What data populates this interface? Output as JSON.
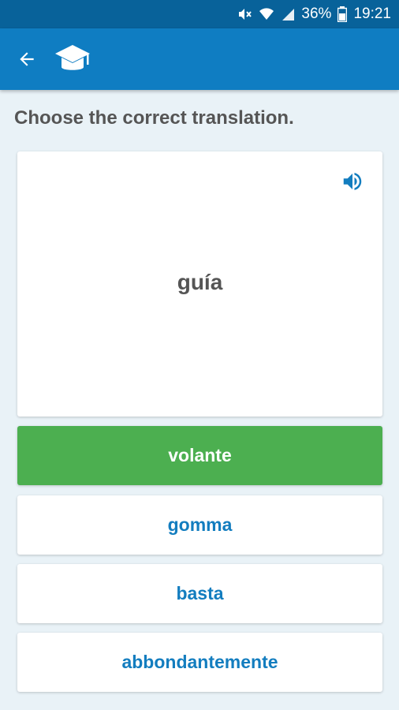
{
  "status_bar": {
    "battery": "36%",
    "time": "19:21",
    "icons": [
      "mute-icon",
      "wifi-icon",
      "signal-icon",
      "battery-icon"
    ]
  },
  "app_bar": {
    "back_icon": "arrow-back-icon",
    "logo_icon": "graduation-cap-icon",
    "color": "#0f7dc2"
  },
  "quiz": {
    "instruction": "Choose the correct translation.",
    "word": "guía",
    "speaker_icon": "speaker-icon",
    "options": [
      {
        "label": "volante",
        "state": "correct"
      },
      {
        "label": "gomma",
        "state": "default"
      },
      {
        "label": "basta",
        "state": "default"
      },
      {
        "label": "abbondantemente",
        "state": "default"
      }
    ]
  },
  "colors": {
    "status_bar": "#08629a",
    "accent": "#137dbf",
    "correct": "#4caf50",
    "background": "#e9f2f7"
  }
}
